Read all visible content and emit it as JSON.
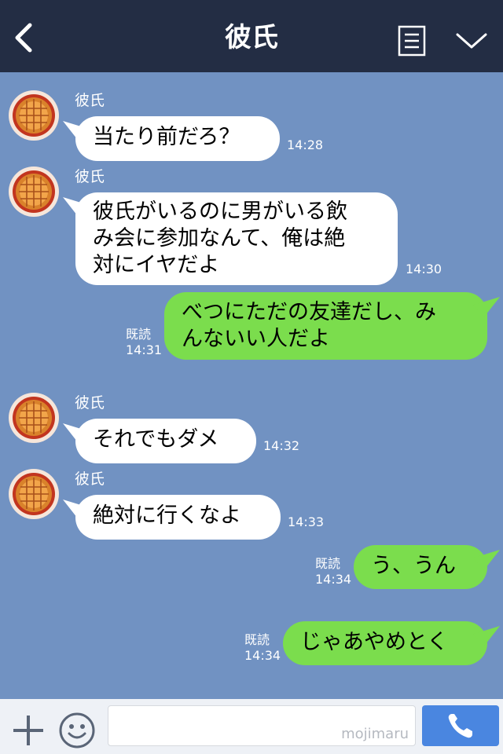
{
  "header": {
    "title": "彼氏"
  },
  "messages": [
    {
      "side": "in",
      "sender": "彼氏",
      "text": "当たり前だろ？",
      "time": "14:28"
    },
    {
      "side": "in",
      "sender": "彼氏",
      "line1": "彼氏がいるのに男がいる飲",
      "line2": "み会に参加なんて、俺は絶",
      "line3": "対にイヤだよ",
      "time": "14:30"
    },
    {
      "side": "out",
      "read": "既読",
      "line1": "べつにただの友達だし、み",
      "line2": "んないい人だよ",
      "time": "14:31"
    },
    {
      "side": "in",
      "sender": "彼氏",
      "text": "それでもダメ",
      "time": "14:32"
    },
    {
      "side": "in",
      "sender": "彼氏",
      "text": "絶対に行くなよ",
      "time": "14:33"
    },
    {
      "side": "out",
      "read": "既読",
      "text": "う、うん",
      "time": "14:34"
    },
    {
      "side": "out",
      "read": "既読",
      "text": "じゃあやめとく",
      "time": "14:34"
    }
  ],
  "footer": {
    "watermark": "mojimaru"
  },
  "colors": {
    "header": "#232d44",
    "background": "#7192c2",
    "outgoing_bubble": "#7bdd4d",
    "incoming_bubble": "#ffffff",
    "call_button": "#4a86e0"
  },
  "icons": [
    "back-icon",
    "menu-icon",
    "chevron-down-icon",
    "plus-icon",
    "smiley-icon",
    "phone-icon",
    "pie-avatar-icon"
  ]
}
